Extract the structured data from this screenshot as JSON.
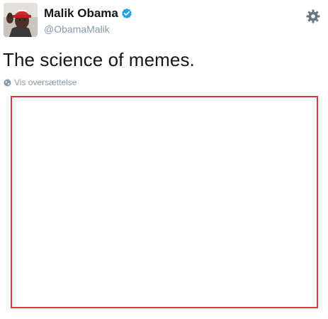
{
  "user": {
    "name": "Malik Obama",
    "handle": "@ObamaMalik",
    "verified": true
  },
  "tweet": {
    "text": "The science of memes.",
    "translate_label": "Vis oversættelse"
  },
  "icons": {
    "verified": "verified-badge-icon",
    "settings": "gear-icon",
    "translate": "globe-icon"
  },
  "colors": {
    "verified_blue": "#1da1f2",
    "muted_text": "#8899a6",
    "media_border": "#d23a3a",
    "hat_red": "#d0282e"
  }
}
